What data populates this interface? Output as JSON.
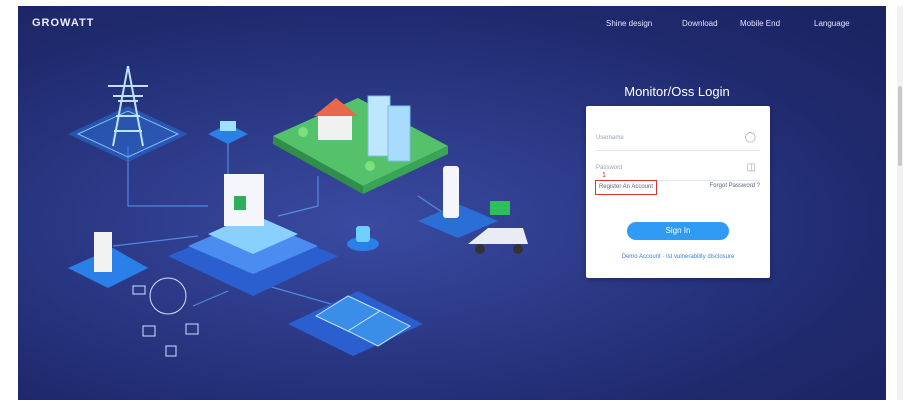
{
  "brand": {
    "logo_text": "GROWATT"
  },
  "nav": {
    "items": [
      "Shine design",
      "Download",
      "Mobile End",
      "Language"
    ]
  },
  "login": {
    "title": "Monitor/Oss Login",
    "username_placeholder": "Username",
    "password_placeholder": "Password",
    "annotation": "1",
    "register_label": "Register An Account",
    "forgot_label": "Forgot Password ?",
    "signin_label": "Sign In",
    "links_text": "Demo Account · Ist vulnerability disclosure"
  },
  "colors": {
    "background": "#263278",
    "accent": "#2f9bf2",
    "highlight_border": "#d9342b"
  },
  "icons": {
    "username": "user-icon",
    "password": "lock-icon"
  }
}
